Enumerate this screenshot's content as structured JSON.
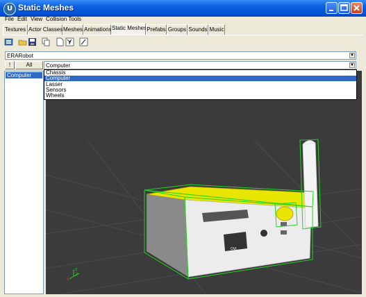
{
  "window": {
    "title": "Static Meshes",
    "logo": "U"
  },
  "menu": [
    "File",
    "Edit",
    "View",
    "Collision Tools"
  ],
  "tabs": [
    "Textures",
    "Actor Classes",
    "Meshes",
    "Animations",
    "Static Meshes",
    "Prefabs",
    "Groups",
    "Sounds",
    "Music"
  ],
  "active_tab": "Static Meshes",
  "toolbar_icons": [
    "import-icon",
    "open-icon",
    "save-icon",
    "copy-icon",
    "new-icon",
    "properties-icon",
    "edit-icon"
  ],
  "package_combo": {
    "value": "ERARobot"
  },
  "group_buttons": {
    "left": "!",
    "all": "All"
  },
  "group_combo": {
    "value": "Computer"
  },
  "group_list": {
    "items": [
      "Chassis",
      "Computer",
      "Lasser",
      "Sensors",
      "Wheels"
    ],
    "selected_index": 1
  },
  "meshes": [
    "Computer"
  ],
  "axis": {
    "x": "x",
    "y": "y",
    "z": "z"
  },
  "device": {
    "port_label": "DVI"
  },
  "colors": {
    "titlebar": "#0550d6",
    "selection": "#316ac5",
    "viewport_bg": "#3b3b3b",
    "bounding_box": "#23d323"
  }
}
